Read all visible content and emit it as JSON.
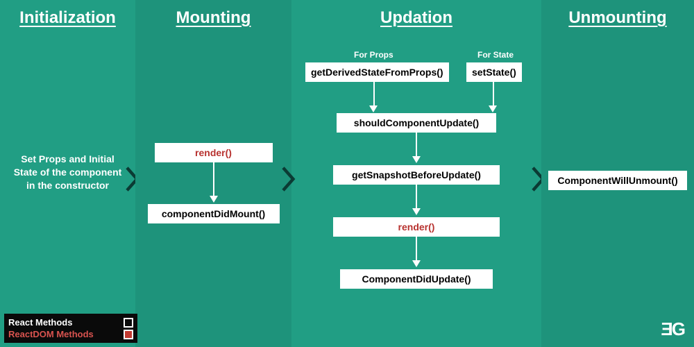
{
  "columns": {
    "init": {
      "title": "Initialization",
      "desc": "Set Props and Initial State of the component in the constructor"
    },
    "mount": {
      "title": "Mounting"
    },
    "update": {
      "title": "Updation"
    },
    "unmount": {
      "title": "Unmounting"
    }
  },
  "mount": {
    "render": "render()",
    "did_mount": "componentDidMount()"
  },
  "update": {
    "for_props_label": "For Props",
    "for_state_label": "For State",
    "get_derived": "getDerivedStateFromProps()",
    "set_state": "setState()",
    "should_update": "shouldComponentUpdate()",
    "get_snapshot": "getSnapshotBeforeUpdate()",
    "render": "render()",
    "did_update": "ComponentDidUpdate()"
  },
  "unmount": {
    "will_unmount": "ComponentWillUnmount()"
  },
  "legend": {
    "react": "React Methods",
    "reactdom": "ReactDOM Methods"
  },
  "logo": "ƎG"
}
